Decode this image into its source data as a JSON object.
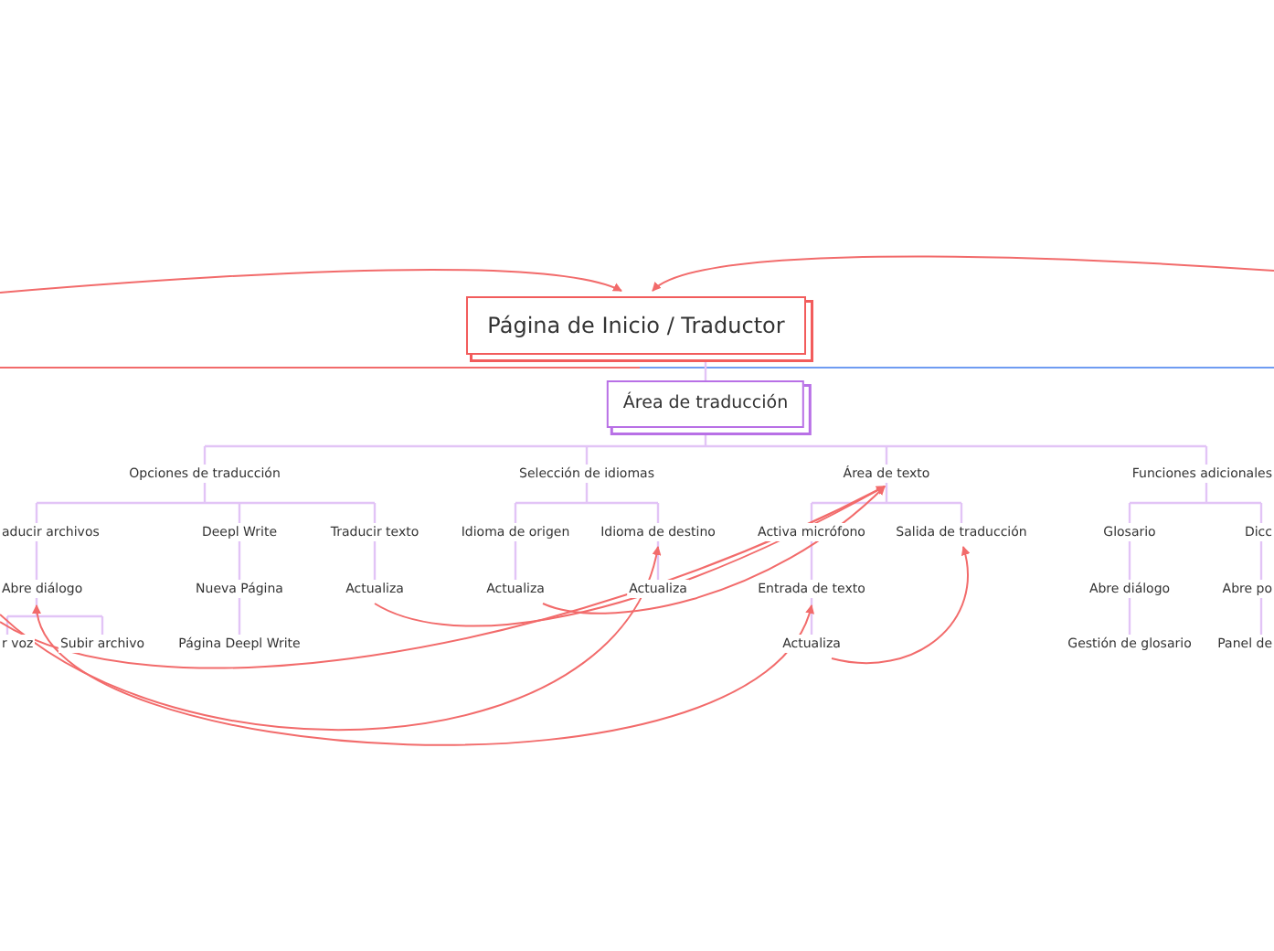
{
  "root": {
    "title": "Página de Inicio / Traductor",
    "children": [
      {
        "title": "Área de traducción",
        "children": [
          {
            "title": "Opciones de traducción",
            "children": [
              {
                "title": "aducir archivos",
                "children": [
                  {
                    "title": "Abre diálogo",
                    "children": [
                      {
                        "title": "r voz"
                      },
                      {
                        "title": "Subir archivo"
                      }
                    ]
                  }
                ]
              },
              {
                "title": "Deepl Write",
                "children": [
                  {
                    "title": "Nueva Página",
                    "children": [
                      {
                        "title": "Página Deepl Write"
                      }
                    ]
                  }
                ]
              },
              {
                "title": "Traducir texto",
                "children": [
                  {
                    "title": "Actualiza"
                  }
                ]
              }
            ]
          },
          {
            "title": "Selección de idiomas",
            "children": [
              {
                "title": "Idioma de origen",
                "children": [
                  {
                    "title": "Actualiza"
                  }
                ]
              },
              {
                "title": "Idioma de destino",
                "children": [
                  {
                    "title": "Actualiza"
                  }
                ]
              }
            ]
          },
          {
            "title": "Área de texto",
            "children": [
              {
                "title": "Activa micrófono",
                "children": [
                  {
                    "title": "Entrada de texto",
                    "children": [
                      {
                        "title": "Actualiza"
                      }
                    ]
                  }
                ]
              },
              {
                "title": "Salida de traducción"
              }
            ]
          },
          {
            "title": "Funciones adicionales",
            "children": [
              {
                "title": "Glosario",
                "children": [
                  {
                    "title": "Abre diálogo",
                    "children": [
                      {
                        "title": "Gestión de glosario"
                      }
                    ]
                  }
                ]
              },
              {
                "title": "Dicc",
                "children": [
                  {
                    "title": "Abre po",
                    "children": [
                      {
                        "title": "Panel de"
                      }
                    ]
                  }
                ]
              }
            ]
          }
        ]
      }
    ]
  }
}
